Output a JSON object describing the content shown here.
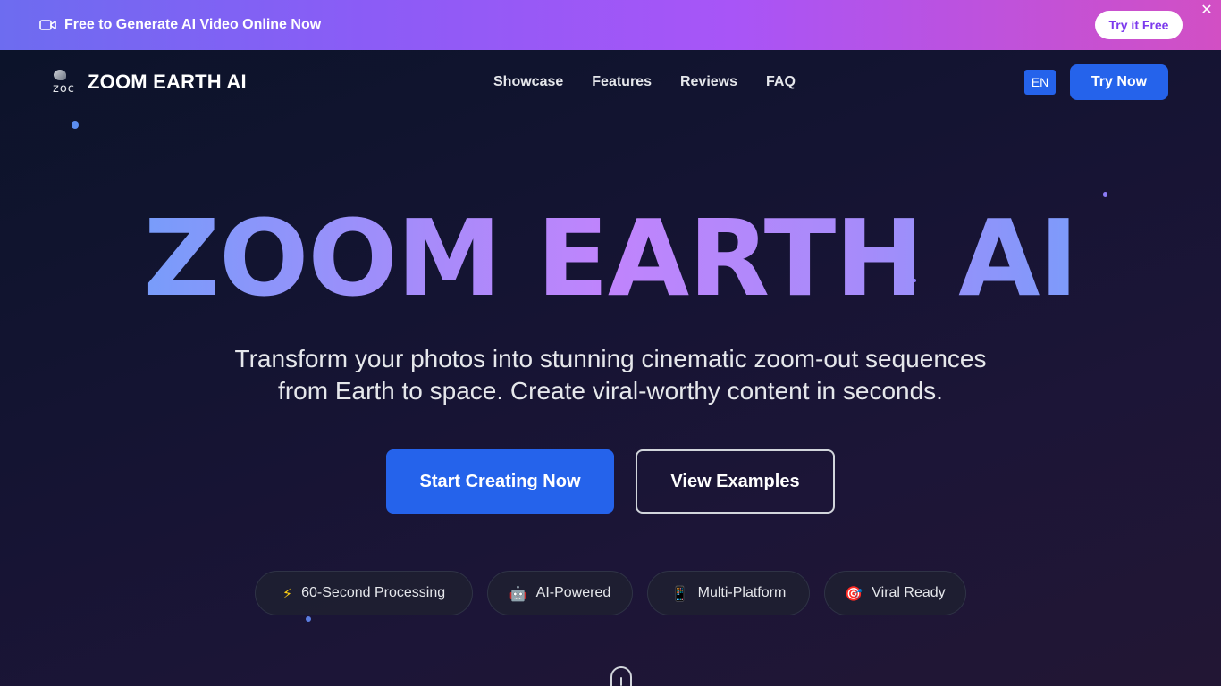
{
  "promo": {
    "text": "Free to Generate AI Video Online Now",
    "cta": "Try it Free",
    "close": "✕"
  },
  "nav": {
    "brand": "ZOOM EARTH AI",
    "logo_alt": "zoc",
    "links": [
      "Showcase",
      "Features",
      "Reviews",
      "FAQ"
    ],
    "lang": "EN",
    "cta": "Try Now"
  },
  "hero": {
    "title": "ZOOM EARTH AI",
    "subtitle_line1": "Transform your photos into stunning cinematic zoom-out sequences",
    "subtitle_line2": "from Earth to space. Create viral-worthy content in seconds.",
    "primary_cta": "Start Creating Now",
    "secondary_cta": "View Examples"
  },
  "features": [
    {
      "icon": "⚡",
      "icon_name": "lightning-icon",
      "label": "60-Second Processing"
    },
    {
      "icon": "🤖",
      "icon_name": "robot-icon",
      "label": "AI-Powered"
    },
    {
      "icon": "📱",
      "icon_name": "phone-icon",
      "label": "Multi-Platform"
    },
    {
      "icon": "🎯",
      "icon_name": "target-icon",
      "label": "Viral Ready"
    }
  ],
  "colors": {
    "accent": "#2563eb",
    "banner_start": "#6d6cf0",
    "banner_end": "#d24fc4",
    "title_gradient_blue": "#60a5fa",
    "title_gradient_purple": "#c084fc"
  }
}
